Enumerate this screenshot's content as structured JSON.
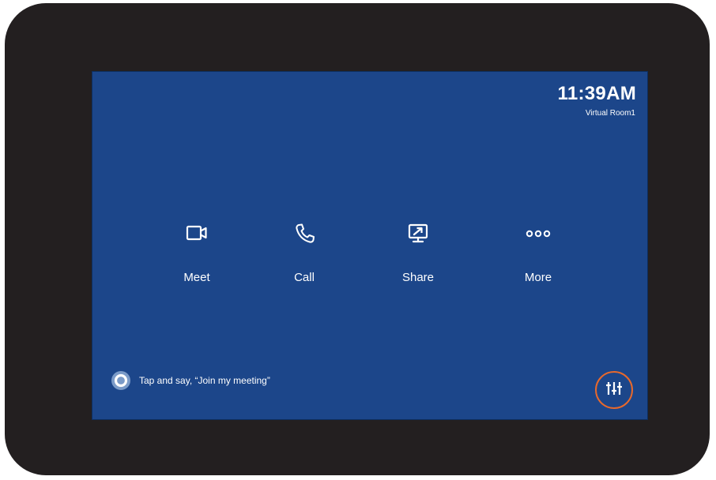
{
  "header": {
    "time": "11:39AM",
    "room_name": "Virtual Room1"
  },
  "actions": [
    {
      "label": "Meet",
      "icon": "video-camera-icon"
    },
    {
      "label": "Call",
      "icon": "phone-icon"
    },
    {
      "label": "Share",
      "icon": "share-screen-icon"
    },
    {
      "label": "More",
      "icon": "more-dots-icon"
    }
  ],
  "cortana": {
    "prompt": "Tap and say, “Join my meeting”",
    "icon": "cortana-ring-icon"
  },
  "settings": {
    "icon": "sliders-icon",
    "highlight_color": "#e8692c"
  },
  "colors": {
    "bezel": "#231f20",
    "screen": "#1c468a",
    "text": "#ffffff"
  }
}
